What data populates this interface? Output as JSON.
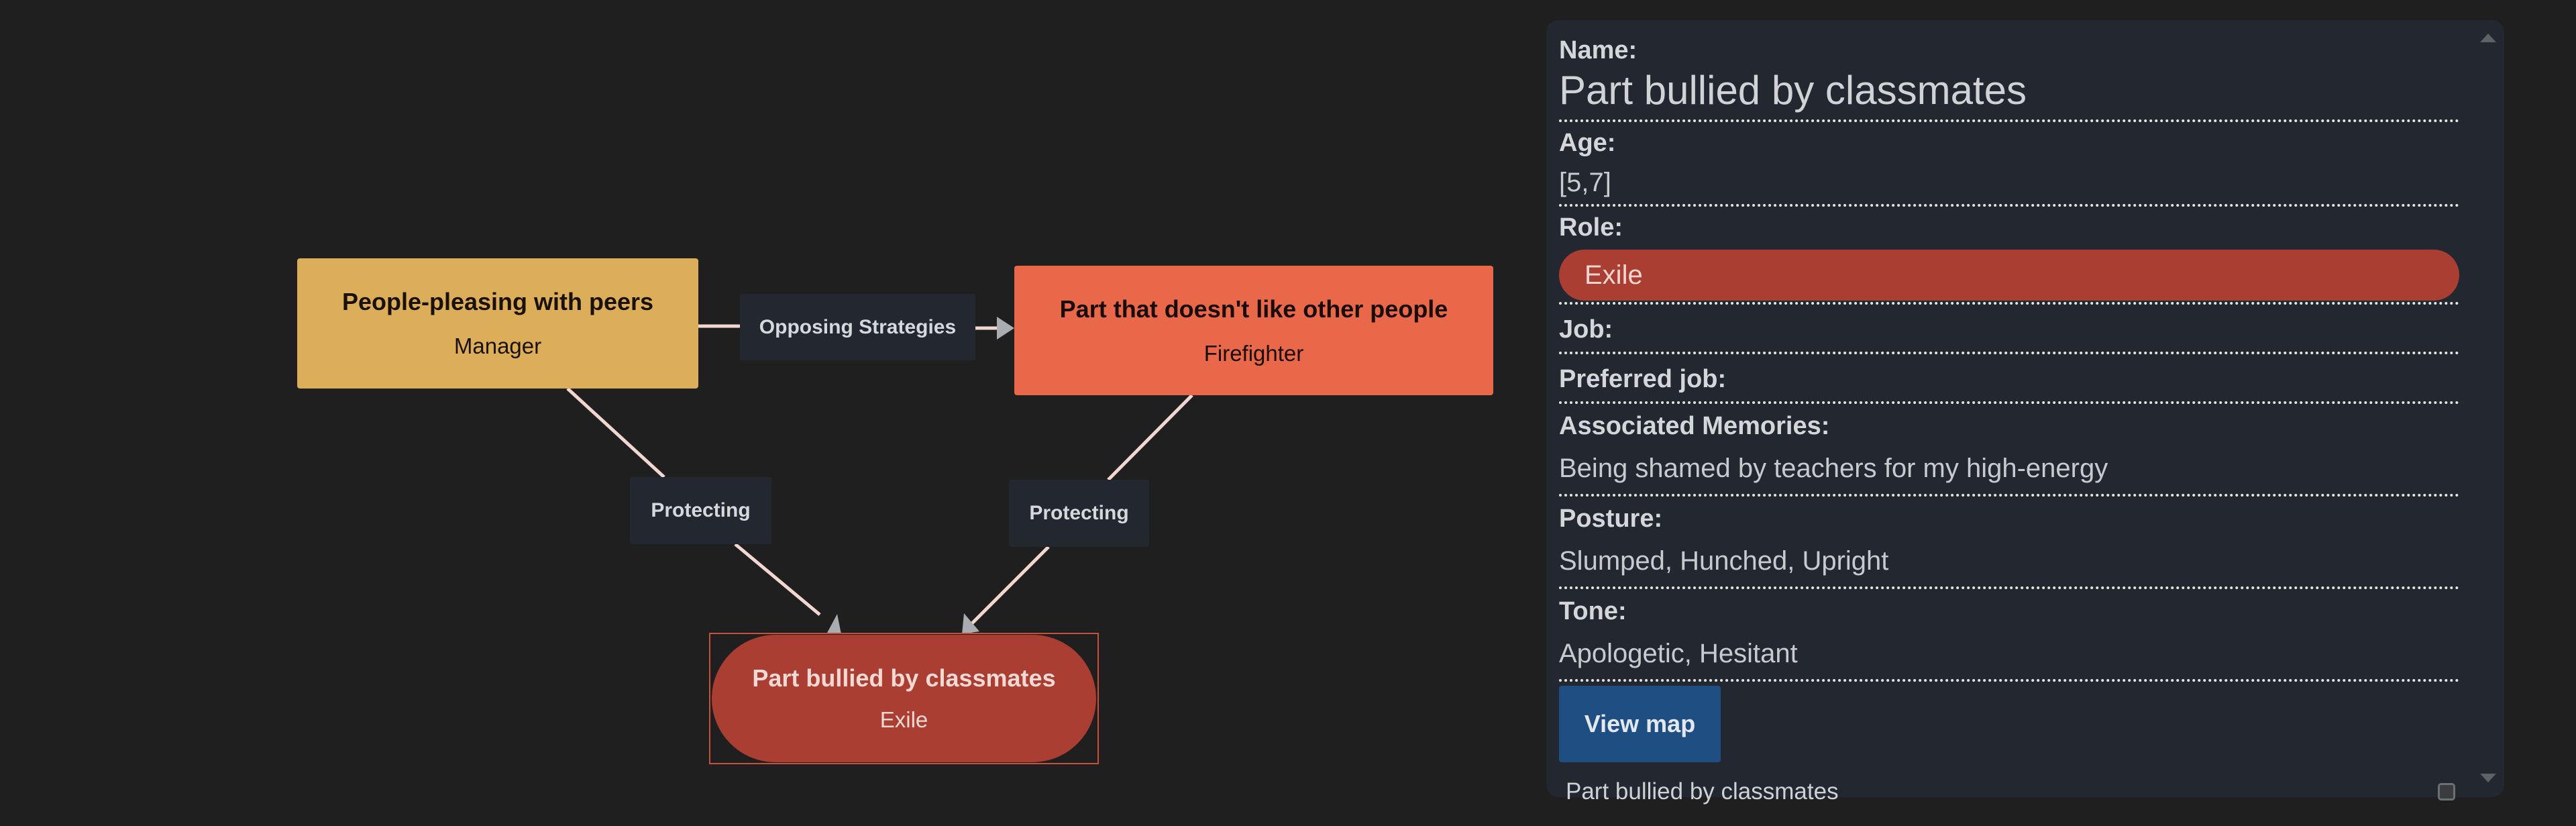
{
  "graph": {
    "nodes": {
      "manager": {
        "title": "People-pleasing with peers",
        "role": "Manager",
        "color": "#dcae5a"
      },
      "firefighter": {
        "title": "Part that doesn't like other people",
        "role": "Firefighter",
        "color": "#e96849"
      },
      "exile": {
        "title": "Part bullied by classmates",
        "role": "Exile",
        "color": "#aa3e32",
        "selected": true
      }
    },
    "edges": [
      {
        "from": "manager",
        "to": "firefighter",
        "label": "Opposing Strategies"
      },
      {
        "from": "manager",
        "to": "exile",
        "label": "Protecting"
      },
      {
        "from": "firefighter",
        "to": "exile",
        "label": "Protecting"
      }
    ],
    "edge_color": "#f2d6d0",
    "arrow_color": "#a9acb1"
  },
  "panel": {
    "name_label": "Name:",
    "name_value": "Part bullied by classmates",
    "age_label": "Age:",
    "age_value": "[5,7]",
    "role_label": "Role:",
    "role_value": "Exile",
    "role_color": "#aa3e32",
    "job_label": "Job:",
    "job_value": "",
    "preferred_job_label": "Preferred job:",
    "preferred_job_value": "",
    "memories_label": "Associated Memories:",
    "memories_value": "Being shamed by teachers for my high-energy",
    "posture_label": "Posture:",
    "posture_value": "Slumped, Hunched, Upright",
    "tone_label": "Tone:",
    "tone_value": "Apologetic, Hesitant",
    "view_map_label": "View map",
    "footer_text": "Part bullied by classmates",
    "footer_checkbox_checked": false
  }
}
